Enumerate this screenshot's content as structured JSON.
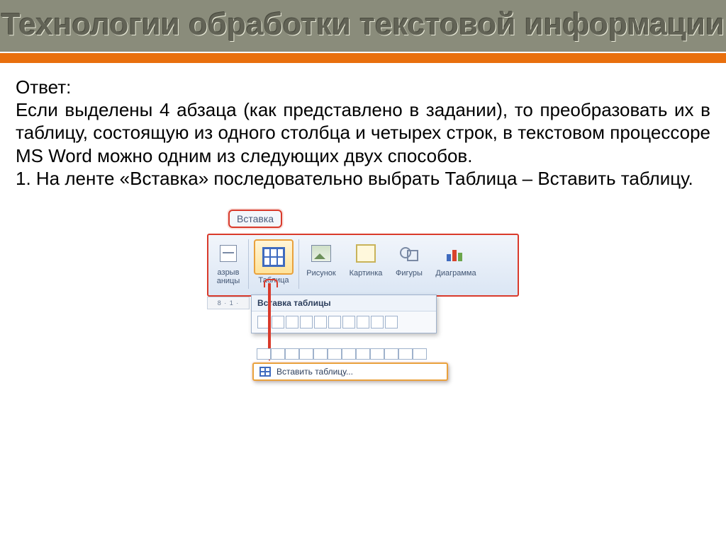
{
  "title": "Технологии обработки текстовой информации",
  "answer_label": "Ответ:",
  "paragraph1": "Если выделены 4 абзаца (как представлено в задании), то преобразовать их в таблицу, состоящую из одного столбца и четырех строк, в текстовом процессоре MS Word можно одним из следующих двух способов.",
  "paragraph2": "1. На ленте «Вставка» последовательно выбрать Таблица – Вставить таблицу.",
  "word": {
    "tab": "Вставка",
    "break_label_line1": "азрыв",
    "break_label_line2": "аницы",
    "table_label": "Таблица",
    "picture_label": "Рисунок",
    "clipart_label": "Картинка",
    "shapes_label": "Фигуры",
    "chart_label": "Диаграмма",
    "dropdown_title": "Вставка таблицы",
    "ruler_text": "8 · 1 ·",
    "menu_item": "Вставить таблицу..."
  }
}
